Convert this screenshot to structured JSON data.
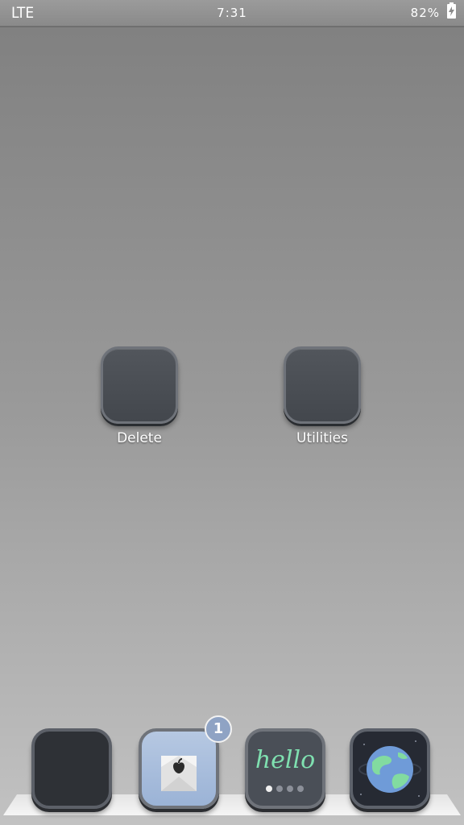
{
  "status_bar": {
    "network": "LTE",
    "time": "7:31",
    "battery": "82%"
  },
  "folders": [
    {
      "label": "Delete"
    },
    {
      "label": "Utilities"
    }
  ],
  "dock": {
    "icons": [
      "dark-app-icon",
      "mail-icon",
      "hello-icon",
      "globe-icon"
    ],
    "mail_badge": "1",
    "hello_text": "hello"
  },
  "colors": {
    "mail_tile": "#9bb3d6",
    "hello_text": "#7fe0b0",
    "badge": "#8fa3c4"
  }
}
